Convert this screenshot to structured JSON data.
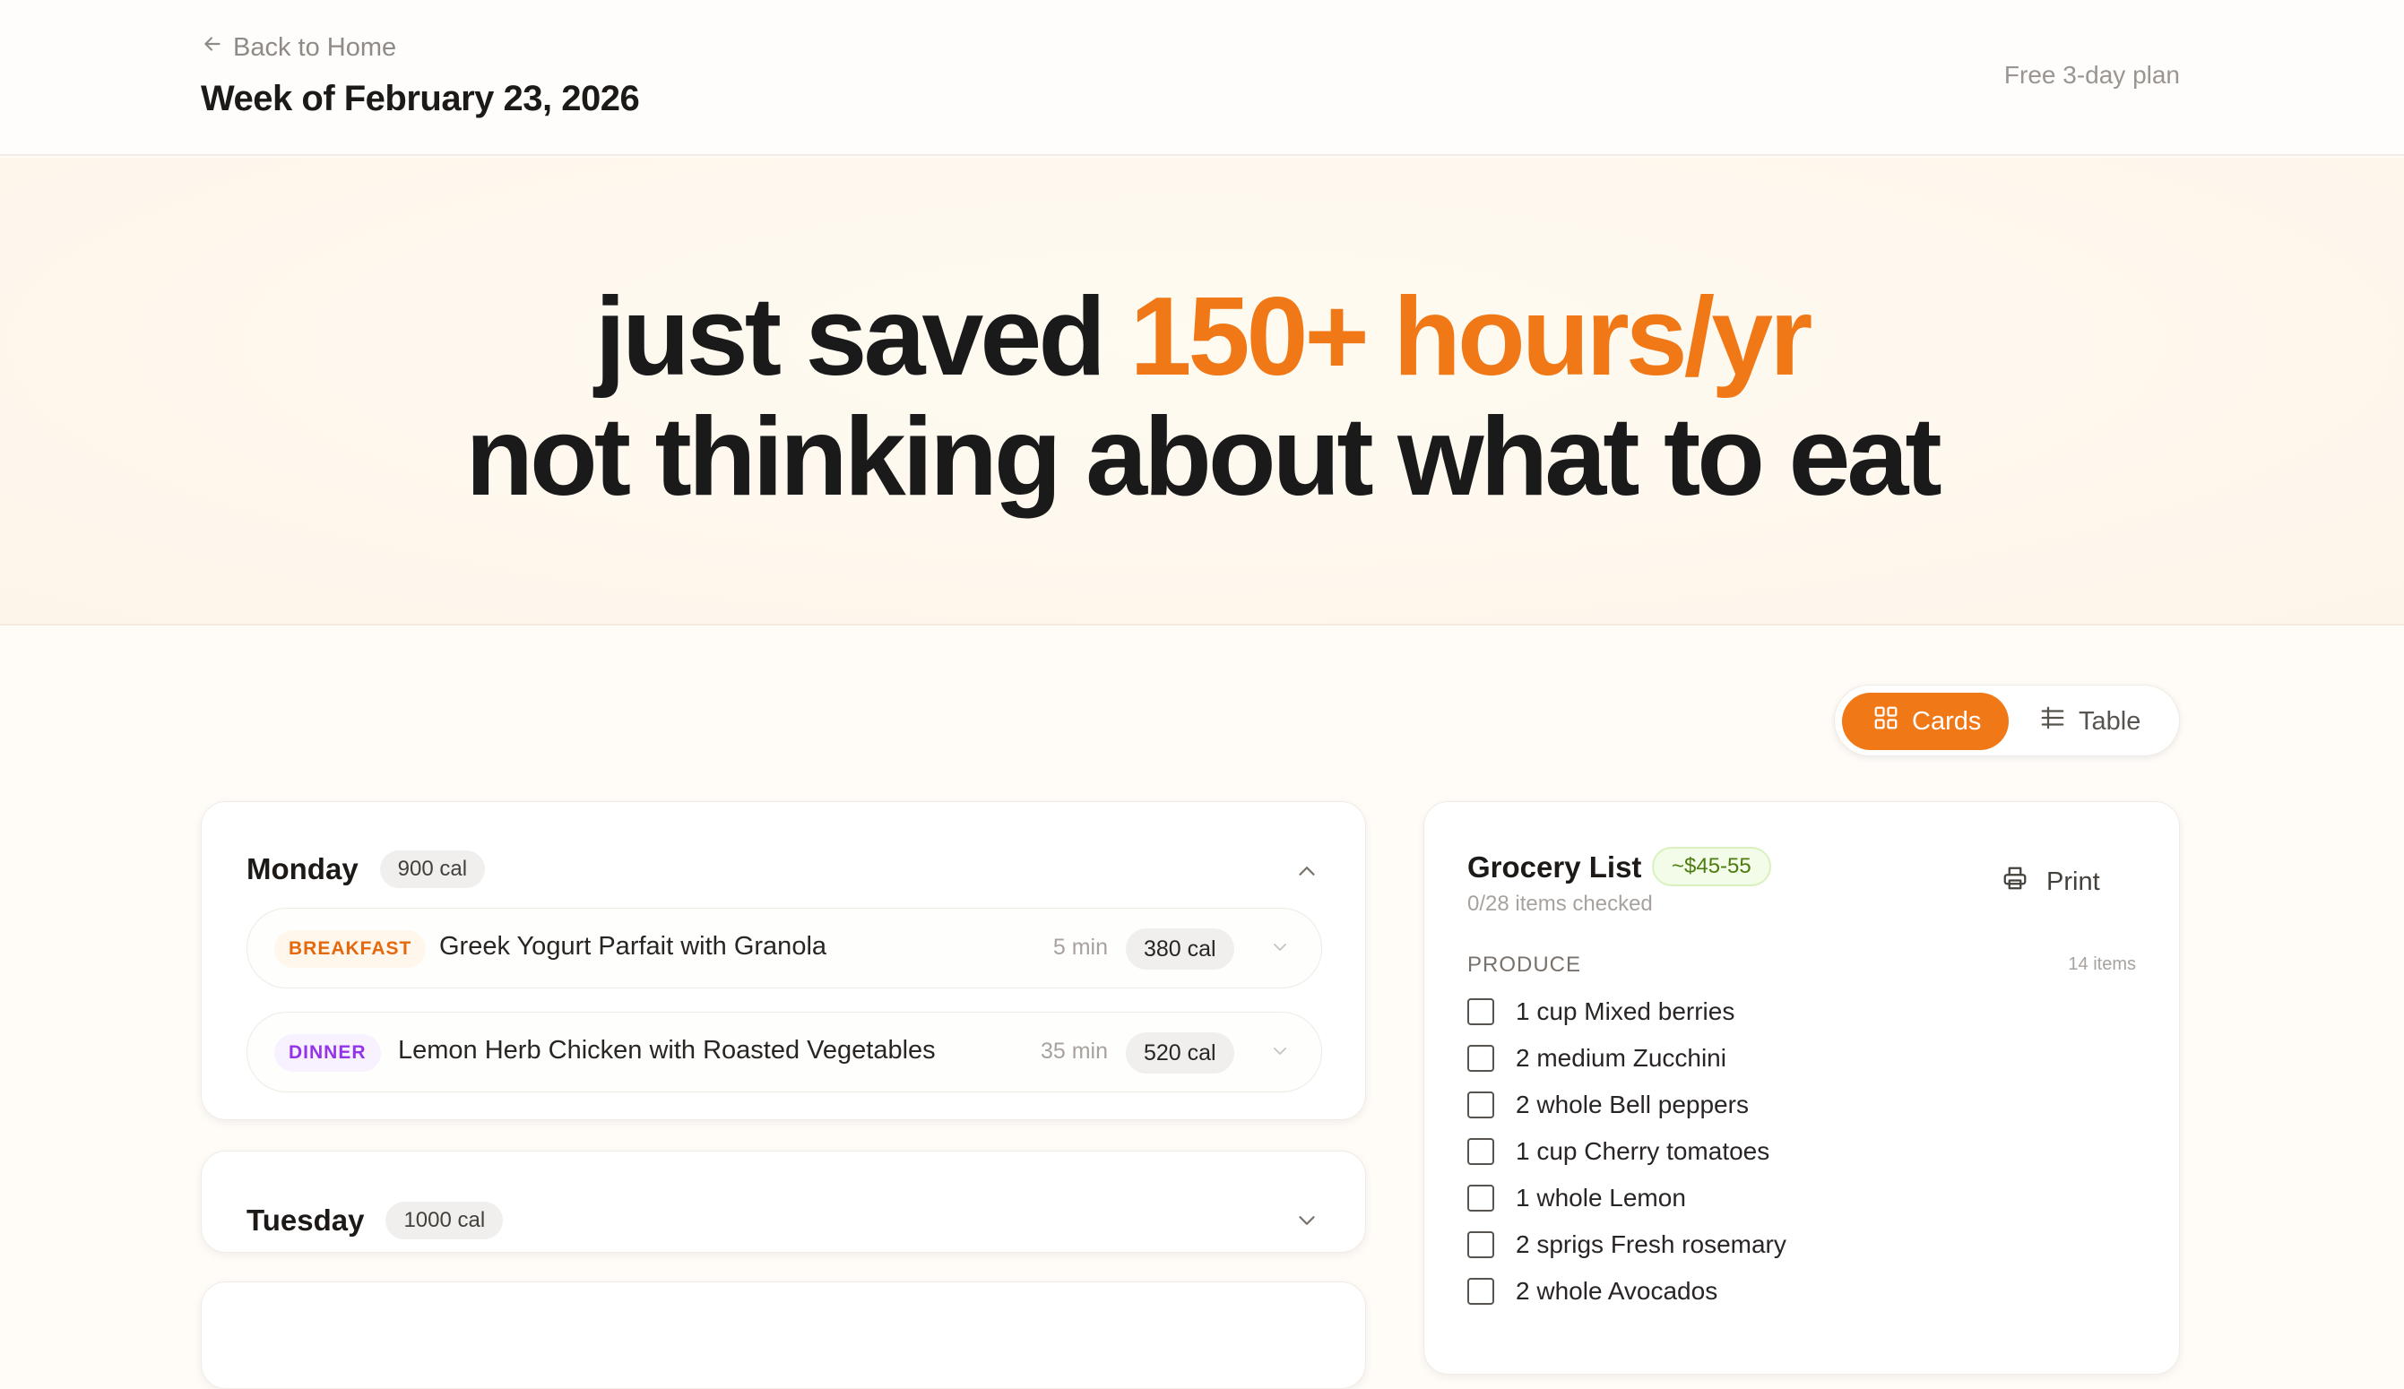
{
  "header": {
    "back_label": "Back to Home",
    "week_title": "Week of February 23, 2026",
    "plan_label": "Free 3-day plan"
  },
  "hero": {
    "line1_prefix": "just saved ",
    "line1_accent": "150+ hours/yr",
    "line2": "not thinking about what to eat",
    "accent_color": "#f07817"
  },
  "view_toggle": {
    "options": [
      {
        "label": "Cards",
        "icon": "grid-icon",
        "active": true
      },
      {
        "label": "Table",
        "icon": "list-icon",
        "active": false
      }
    ],
    "active_color": "#f07817"
  },
  "days": [
    {
      "name": "Monday",
      "calories": "900 cal",
      "expanded": true,
      "meals": [
        {
          "tag": "BREAKFAST",
          "name": "Greek Yogurt Parfait with Granola",
          "time": "5 min",
          "calories": "380 cal"
        },
        {
          "tag": "DINNER",
          "name": "Lemon Herb Chicken with Roasted Vegetables",
          "time": "35 min",
          "calories": "520 cal"
        }
      ]
    },
    {
      "name": "Tuesday",
      "calories": "1000 cal",
      "expanded": false
    }
  ],
  "grocery": {
    "title": "Grocery List",
    "price": "~$45-55",
    "checked": "0/28 items checked",
    "print_label": "Print",
    "section": {
      "name": "PRODUCE",
      "count": "14 items",
      "items": [
        "1 cup Mixed berries",
        "2 medium Zucchini",
        "2 whole Bell peppers",
        "1 cup Cherry tomatoes",
        "1 whole Lemon",
        "2 sprigs Fresh rosemary",
        "2 whole Avocados"
      ]
    }
  }
}
